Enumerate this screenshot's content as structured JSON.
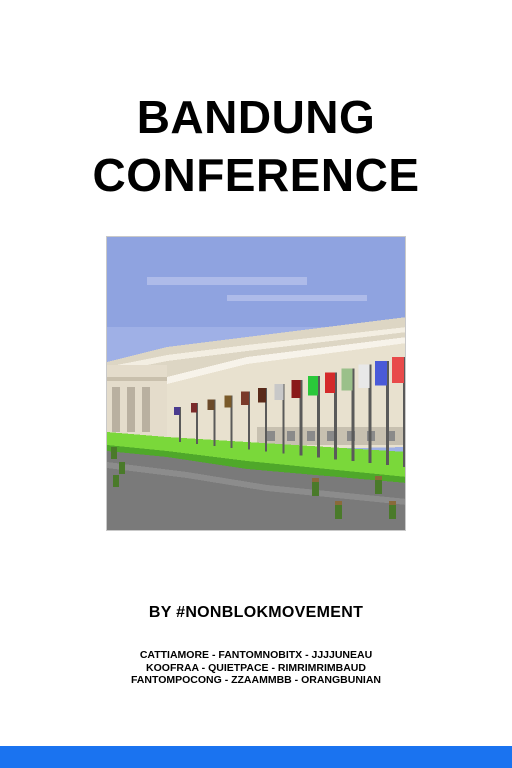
{
  "title": {
    "line1": "BANDUNG",
    "line2": "CONFERENCE"
  },
  "artwork": {
    "flag_colors": [
      "#4a3b8f",
      "#7a2a2a",
      "#6b4a2a",
      "#7a5a2a",
      "#7a3a2a",
      "#5a2a1a",
      "#c8c8c8",
      "#8a1a1a",
      "#2ac83a",
      "#d42a2a",
      "#9ac08a",
      "#e8e8e8",
      "#4a5ad8",
      "#e84a4a"
    ]
  },
  "byline": "BY #NONBLOKMOVEMENT",
  "credits": [
    "CATTIAMORE - FANTOMNOBITX - JJJJUNEAU",
    "KOOFRAA - QUIETPACE - RIMRIMRIMBAUD",
    "FANTOMPOCONG - ZZAAMMBB - ORANGBUNIAN"
  ],
  "colors": {
    "accent_bar": "#1a73f0",
    "sky": "#9fb0e6",
    "building": "#e6dfcf",
    "lawn": "#7ad83a",
    "road": "#7a7a7a"
  }
}
